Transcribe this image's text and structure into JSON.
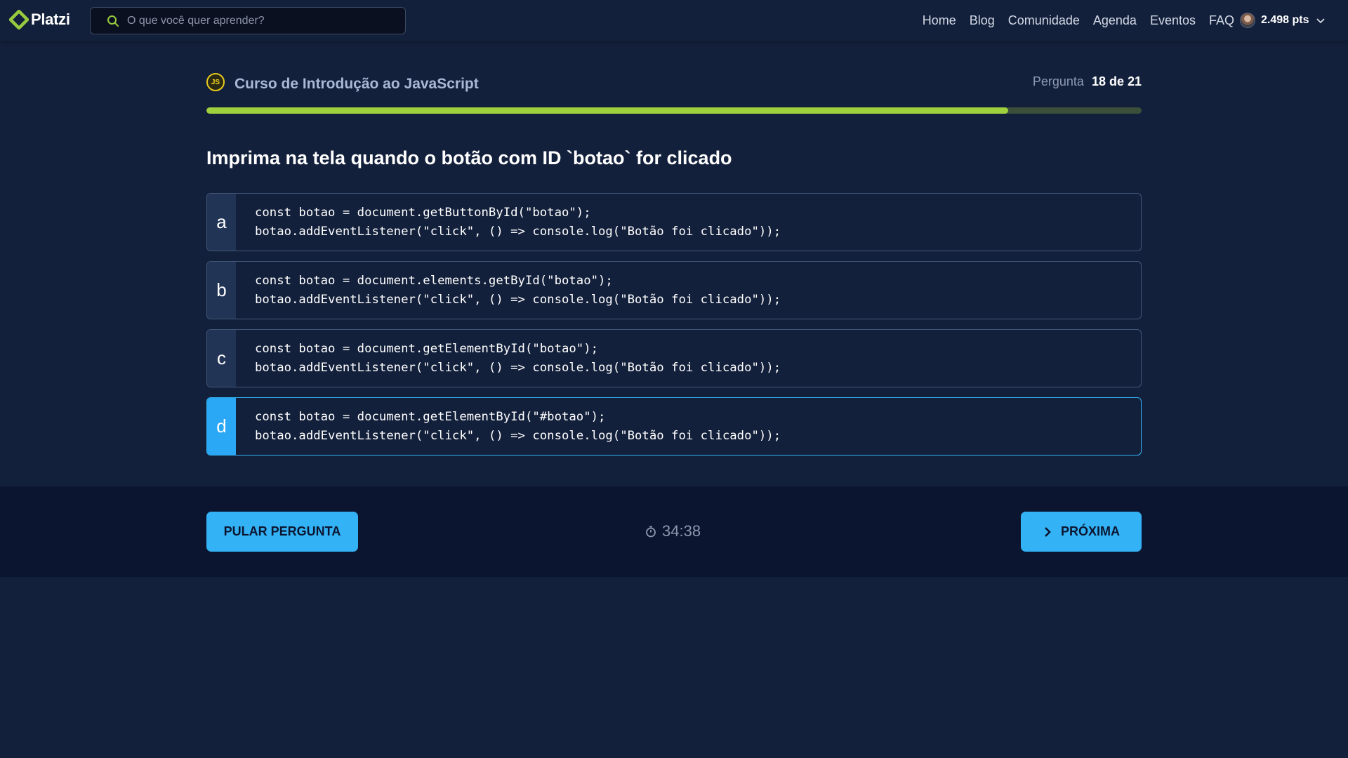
{
  "brand": {
    "name": "Platzi",
    "color": "#98ca3f"
  },
  "search": {
    "placeholder": "O que você quer aprender?",
    "value": ""
  },
  "nav": {
    "items": [
      "Home",
      "Blog",
      "Comunidade",
      "Agenda",
      "Eventos",
      "FAQ"
    ]
  },
  "user": {
    "points": "2.498 pts",
    "icon": "chevron-down-icon"
  },
  "course": {
    "badge": "JS",
    "title": "Curso de Introdução ao JavaScript",
    "question_label": "Pergunta",
    "question_value": "18 de 21",
    "progress_fraction": 0.857,
    "progress_color": "#9ed13d"
  },
  "question": {
    "text": "Imprima na tela quando o botão com ID `botao` for clicado"
  },
  "options": [
    {
      "letter": "a",
      "line1": "const botao = document.getButtonById(\"botao\");",
      "line2": "botao.addEventListener(\"click\", () => console.log(\"Botão foi clicado\"));",
      "selected": false
    },
    {
      "letter": "b",
      "line1": "const botao = document.elements.getById(\"botao\");",
      "line2": "botao.addEventListener(\"click\", () => console.log(\"Botão foi clicado\"));",
      "selected": false
    },
    {
      "letter": "c",
      "line1": "const botao = document.getElementById(\"botao\");",
      "line2": "botao.addEventListener(\"click\", () => console.log(\"Botão foi clicado\"));",
      "selected": false
    },
    {
      "letter": "d",
      "line1": "const botao = document.getElementById(\"#botao\");",
      "line2": "botao.addEventListener(\"click\", () => console.log(\"Botão foi clicado\"));",
      "selected": true
    }
  ],
  "footer": {
    "skip_label": "PULAR PERGUNTA",
    "timer": "34:38",
    "timer_icon": "stopwatch-icon",
    "next_label": "PRÓXIMA",
    "next_icon": "chevron-right-icon",
    "accent": "#33b3f5"
  }
}
